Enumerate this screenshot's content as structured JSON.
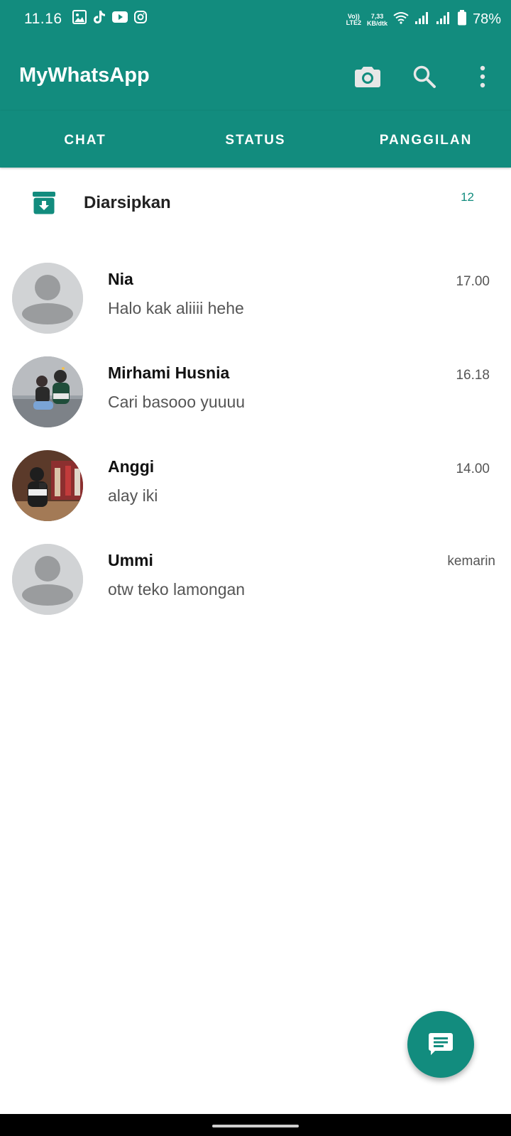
{
  "status_bar": {
    "time": "11.16",
    "volte_top": "Vo))",
    "volte_bottom": "LTE2",
    "speed_value": "7,33",
    "speed_unit": "KB/dtk",
    "battery": "78%",
    "app_icons": [
      "gallery-icon",
      "tiktok-icon",
      "youtube-icon",
      "instagram-icon"
    ]
  },
  "app_bar": {
    "title": "MyWhatsApp",
    "actions": [
      "camera-icon",
      "search-icon",
      "more-vert-icon"
    ]
  },
  "tabs": [
    {
      "label": "CHAT"
    },
    {
      "label": "STATUS"
    },
    {
      "label": "PANGGILAN"
    }
  ],
  "archived": {
    "label": "Diarsipkan",
    "count": "12"
  },
  "chats": [
    {
      "name": "Nia",
      "message": "Halo kak aliiii hehe",
      "time": "17.00",
      "avatar": "default"
    },
    {
      "name": "Mirhami Husnia",
      "message": "Cari basooo yuuuu",
      "time": "16.18",
      "avatar": "photo"
    },
    {
      "name": "Anggi",
      "message": "alay iki",
      "time": "14.00",
      "avatar": "photo"
    },
    {
      "name": "Ummi",
      "message": "otw teko lamongan",
      "time": "kemarin",
      "avatar": "default"
    }
  ],
  "fab": {
    "icon": "new-chat-icon"
  },
  "colors": {
    "primary": "#128c7e",
    "avatar_bg": "#d1d3d5",
    "avatar_fg": "#9a9c9e"
  }
}
